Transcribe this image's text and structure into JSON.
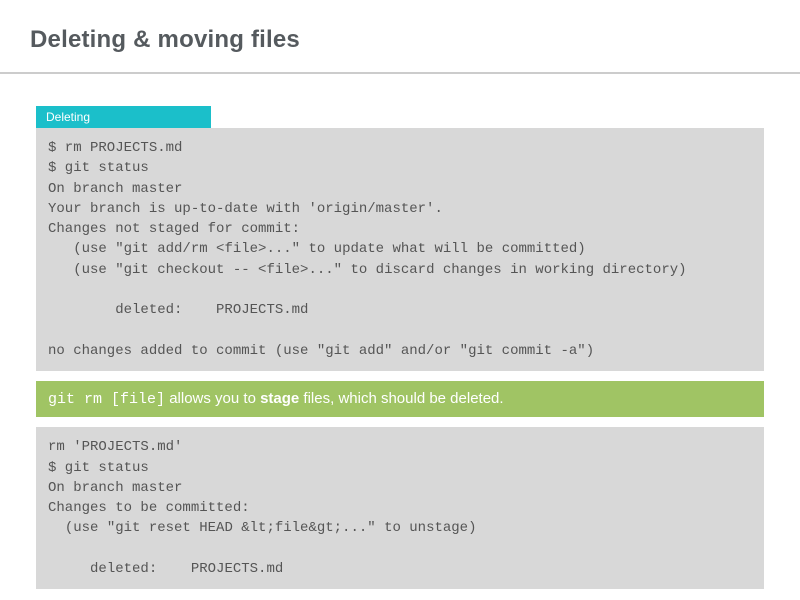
{
  "header": {
    "title": "Deleting & moving files"
  },
  "section1": {
    "label": "Deleting",
    "code": "$ rm PROJECTS.md\n$ git status\nOn branch master\nYour branch is up-to-date with 'origin/master'.\nChanges not staged for commit:\n   (use \"git add/rm <file>...\" to update what will be committed)\n   (use \"git checkout -- <file>...\" to discard changes in working directory)\n\n        deleted:    PROJECTS.md\n\nno changes added to commit (use \"git add\" and/or \"git commit -a\")"
  },
  "callout": {
    "cmd": "git rm [file]",
    "pre": " allows you to ",
    "bold": "stage",
    "post": " files, which should be deleted."
  },
  "section2": {
    "code": "rm 'PROJECTS.md'\n$ git status\nOn branch master\nChanges to be committed:\n  (use \"git reset HEAD &lt;file&gt;...\" to unstage)\n\n     deleted:    PROJECTS.md"
  }
}
